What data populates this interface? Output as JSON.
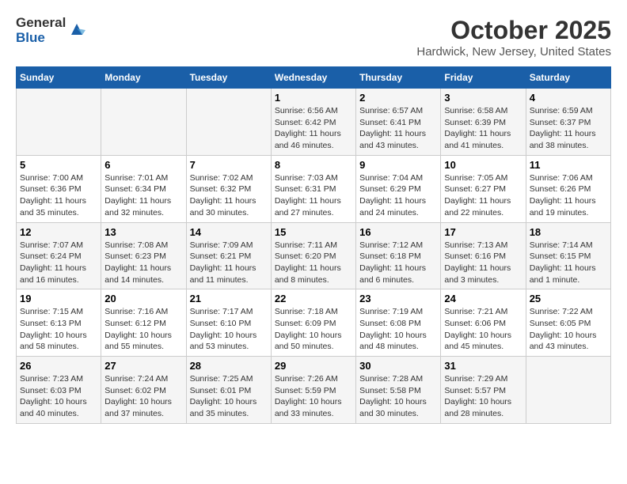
{
  "header": {
    "logo_general": "General",
    "logo_blue": "Blue",
    "month": "October 2025",
    "location": "Hardwick, New Jersey, United States"
  },
  "days_of_week": [
    "Sunday",
    "Monday",
    "Tuesday",
    "Wednesday",
    "Thursday",
    "Friday",
    "Saturday"
  ],
  "weeks": [
    [
      {
        "day": "",
        "info": ""
      },
      {
        "day": "",
        "info": ""
      },
      {
        "day": "",
        "info": ""
      },
      {
        "day": "1",
        "info": "Sunrise: 6:56 AM\nSunset: 6:42 PM\nDaylight: 11 hours and 46 minutes."
      },
      {
        "day": "2",
        "info": "Sunrise: 6:57 AM\nSunset: 6:41 PM\nDaylight: 11 hours and 43 minutes."
      },
      {
        "day": "3",
        "info": "Sunrise: 6:58 AM\nSunset: 6:39 PM\nDaylight: 11 hours and 41 minutes."
      },
      {
        "day": "4",
        "info": "Sunrise: 6:59 AM\nSunset: 6:37 PM\nDaylight: 11 hours and 38 minutes."
      }
    ],
    [
      {
        "day": "5",
        "info": "Sunrise: 7:00 AM\nSunset: 6:36 PM\nDaylight: 11 hours and 35 minutes."
      },
      {
        "day": "6",
        "info": "Sunrise: 7:01 AM\nSunset: 6:34 PM\nDaylight: 11 hours and 32 minutes."
      },
      {
        "day": "7",
        "info": "Sunrise: 7:02 AM\nSunset: 6:32 PM\nDaylight: 11 hours and 30 minutes."
      },
      {
        "day": "8",
        "info": "Sunrise: 7:03 AM\nSunset: 6:31 PM\nDaylight: 11 hours and 27 minutes."
      },
      {
        "day": "9",
        "info": "Sunrise: 7:04 AM\nSunset: 6:29 PM\nDaylight: 11 hours and 24 minutes."
      },
      {
        "day": "10",
        "info": "Sunrise: 7:05 AM\nSunset: 6:27 PM\nDaylight: 11 hours and 22 minutes."
      },
      {
        "day": "11",
        "info": "Sunrise: 7:06 AM\nSunset: 6:26 PM\nDaylight: 11 hours and 19 minutes."
      }
    ],
    [
      {
        "day": "12",
        "info": "Sunrise: 7:07 AM\nSunset: 6:24 PM\nDaylight: 11 hours and 16 minutes."
      },
      {
        "day": "13",
        "info": "Sunrise: 7:08 AM\nSunset: 6:23 PM\nDaylight: 11 hours and 14 minutes."
      },
      {
        "day": "14",
        "info": "Sunrise: 7:09 AM\nSunset: 6:21 PM\nDaylight: 11 hours and 11 minutes."
      },
      {
        "day": "15",
        "info": "Sunrise: 7:11 AM\nSunset: 6:20 PM\nDaylight: 11 hours and 8 minutes."
      },
      {
        "day": "16",
        "info": "Sunrise: 7:12 AM\nSunset: 6:18 PM\nDaylight: 11 hours and 6 minutes."
      },
      {
        "day": "17",
        "info": "Sunrise: 7:13 AM\nSunset: 6:16 PM\nDaylight: 11 hours and 3 minutes."
      },
      {
        "day": "18",
        "info": "Sunrise: 7:14 AM\nSunset: 6:15 PM\nDaylight: 11 hours and 1 minute."
      }
    ],
    [
      {
        "day": "19",
        "info": "Sunrise: 7:15 AM\nSunset: 6:13 PM\nDaylight: 10 hours and 58 minutes."
      },
      {
        "day": "20",
        "info": "Sunrise: 7:16 AM\nSunset: 6:12 PM\nDaylight: 10 hours and 55 minutes."
      },
      {
        "day": "21",
        "info": "Sunrise: 7:17 AM\nSunset: 6:10 PM\nDaylight: 10 hours and 53 minutes."
      },
      {
        "day": "22",
        "info": "Sunrise: 7:18 AM\nSunset: 6:09 PM\nDaylight: 10 hours and 50 minutes."
      },
      {
        "day": "23",
        "info": "Sunrise: 7:19 AM\nSunset: 6:08 PM\nDaylight: 10 hours and 48 minutes."
      },
      {
        "day": "24",
        "info": "Sunrise: 7:21 AM\nSunset: 6:06 PM\nDaylight: 10 hours and 45 minutes."
      },
      {
        "day": "25",
        "info": "Sunrise: 7:22 AM\nSunset: 6:05 PM\nDaylight: 10 hours and 43 minutes."
      }
    ],
    [
      {
        "day": "26",
        "info": "Sunrise: 7:23 AM\nSunset: 6:03 PM\nDaylight: 10 hours and 40 minutes."
      },
      {
        "day": "27",
        "info": "Sunrise: 7:24 AM\nSunset: 6:02 PM\nDaylight: 10 hours and 37 minutes."
      },
      {
        "day": "28",
        "info": "Sunrise: 7:25 AM\nSunset: 6:01 PM\nDaylight: 10 hours and 35 minutes."
      },
      {
        "day": "29",
        "info": "Sunrise: 7:26 AM\nSunset: 5:59 PM\nDaylight: 10 hours and 33 minutes."
      },
      {
        "day": "30",
        "info": "Sunrise: 7:28 AM\nSunset: 5:58 PM\nDaylight: 10 hours and 30 minutes."
      },
      {
        "day": "31",
        "info": "Sunrise: 7:29 AM\nSunset: 5:57 PM\nDaylight: 10 hours and 28 minutes."
      },
      {
        "day": "",
        "info": ""
      }
    ]
  ]
}
